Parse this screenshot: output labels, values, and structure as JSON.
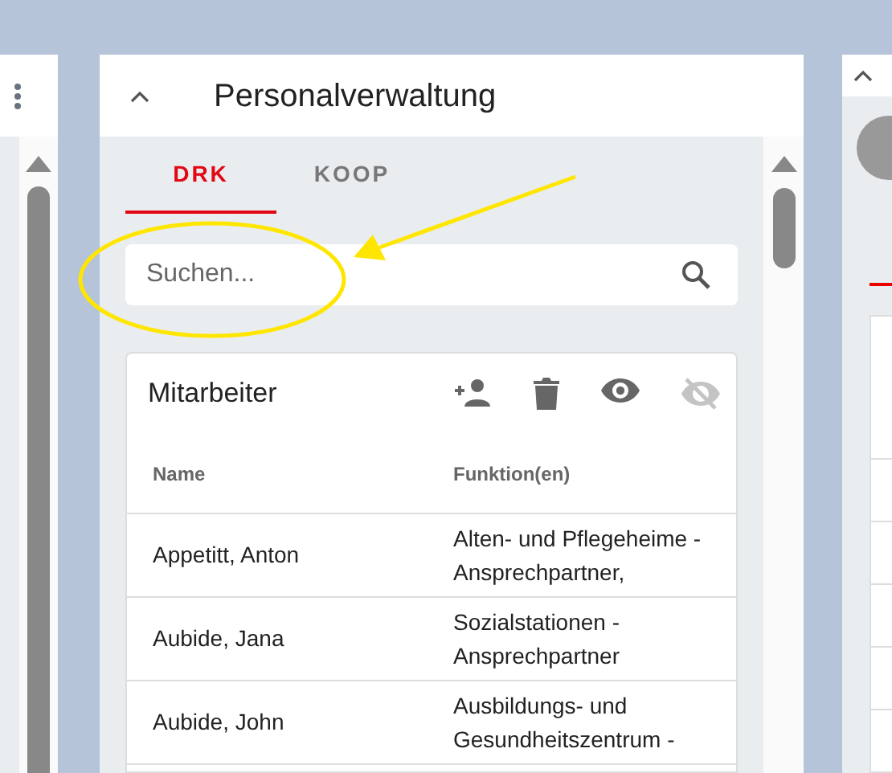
{
  "panel": {
    "title": "Personalverwaltung",
    "expanded": true
  },
  "tabs": [
    {
      "label": "DRK",
      "selected": true
    },
    {
      "label": "KOOP",
      "selected": false
    }
  ],
  "search": {
    "placeholder": "Suchen..."
  },
  "card": {
    "title": "Mitarbeiter",
    "actions": [
      {
        "kind": "add-person",
        "disabled": false
      },
      {
        "kind": "delete",
        "disabled": false
      },
      {
        "kind": "show",
        "disabled": false
      },
      {
        "kind": "hide",
        "disabled": true
      }
    ]
  },
  "table": {
    "columns": [
      "Name",
      "Funktion(en)"
    ],
    "rows": [
      {
        "name": "Appetitt, Anton",
        "function": "Alten- und Pflegeheime - Ansprechpartner,"
      },
      {
        "name": "Aubide, Jana",
        "function": "Sozialstationen - Ansprechpartner"
      },
      {
        "name": "Aubide, John",
        "function": "Ausbildungs- und Gesundheitszentrum -"
      }
    ]
  },
  "annotation": {
    "ellipse": true,
    "arrow": true
  }
}
